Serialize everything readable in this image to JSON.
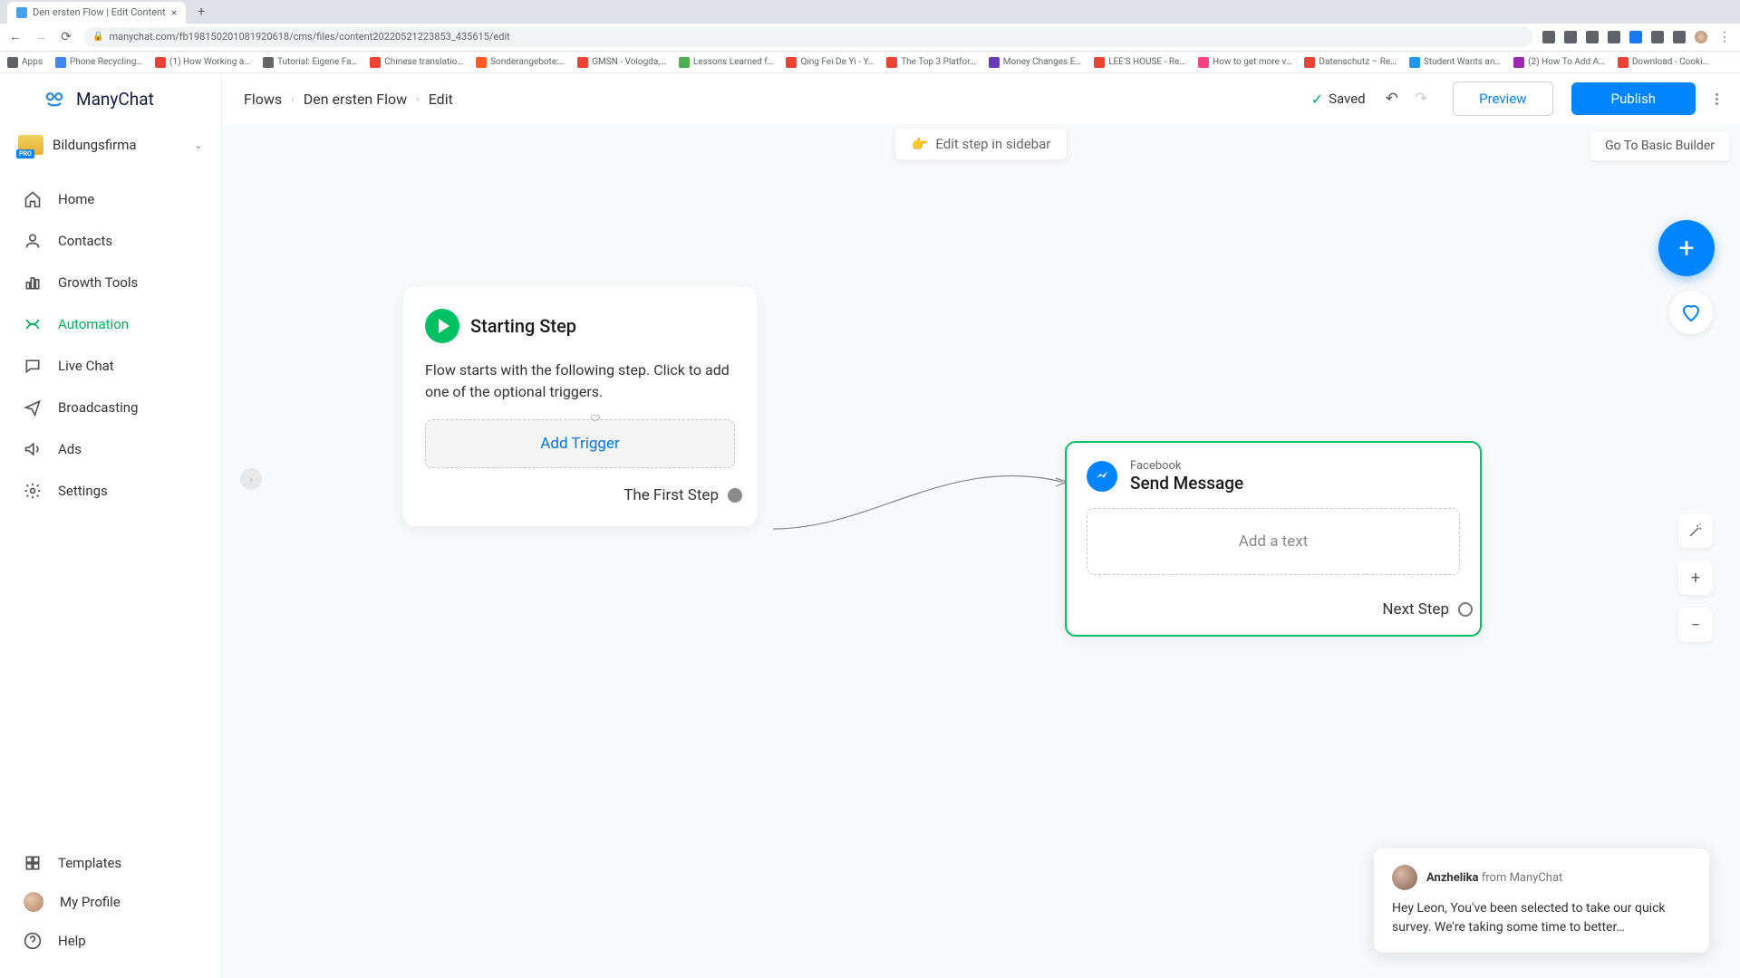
{
  "browser": {
    "tab_title": "Den ersten Flow | Edit Content",
    "url": "manychat.com/fb198150201081920618/cms/files/content20220521223853_435615/edit",
    "bookmarks": [
      "Apps",
      "Phone Recycling…",
      "(1) How Working a…",
      "Tutorial: Eigene Fa…",
      "Chinese translatio…",
      "Sonderangebote:…",
      "GMSN - Vologda,…",
      "Lessons Learned f…",
      "Qing Fei De Yi - Y…",
      "The Top 3 Platfor…",
      "Money Changes E…",
      "LEE'S HOUSE - Re…",
      "How to get more v…",
      "Datenschutz – Re…",
      "Student Wants an…",
      "(2) How To Add A…",
      "Download - Cooki…"
    ]
  },
  "logo": "ManyChat",
  "workspace": {
    "name": "Bildungsfirma",
    "badge": "PRO"
  },
  "nav": {
    "primary": [
      "Home",
      "Contacts",
      "Growth Tools",
      "Automation",
      "Live Chat",
      "Broadcasting",
      "Ads",
      "Settings"
    ],
    "bottom": [
      "Templates",
      "My Profile",
      "Help"
    ]
  },
  "topbar": {
    "crumbs": [
      "Flows",
      "Den ersten Flow",
      "Edit"
    ],
    "saved": "Saved",
    "preview": "Preview",
    "publish": "Publish"
  },
  "canvas_bar": {
    "hint": "Edit step in sidebar",
    "basic": "Go To Basic Builder"
  },
  "start_card": {
    "title": "Starting Step",
    "desc": "Flow starts with the following step. Click to add one of the optional triggers.",
    "add_trigger": "Add Trigger",
    "first_step": "The First Step"
  },
  "msg_card": {
    "source": "Facebook",
    "title": "Send Message",
    "add_text": "Add a text",
    "next": "Next Step"
  },
  "chat": {
    "name": "Anzhelika",
    "from": "from ManyChat",
    "body": "Hey Leon,  You've been selected to take our quick survey. We're taking some time to better…"
  }
}
